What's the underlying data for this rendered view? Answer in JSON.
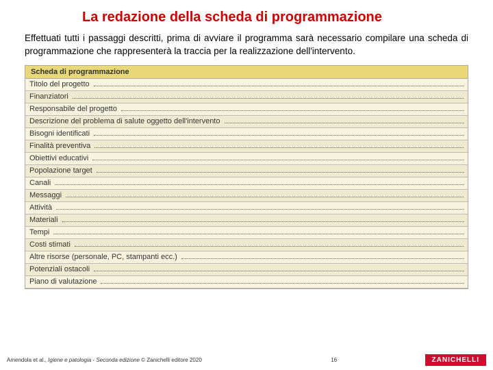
{
  "title": "La redazione della scheda di programmazione",
  "intro": "Effettuati tutti i passaggi descritti, prima di avviare il programma sarà necessario compilare una scheda di programmazione che rappresenterà la traccia per la realizzazione dell'intervento.",
  "table": {
    "header": "Scheda di programmazione",
    "rows": [
      "Titolo del progetto",
      "Finanziatori",
      "Responsabile del progetto",
      "Descrizione del problema di salute oggetto dell'intervento",
      "Bisogni identificati",
      "Finalità preventiva",
      "Obiettivi educativi",
      "Popolazione target",
      "Canali",
      "Messaggi",
      "Attività",
      "Materiali",
      "Tempi",
      "Costi stimati",
      "Altre risorse (personale, PC, stampanti ecc.)",
      "Potenziali ostacoli",
      "Piano di valutazione"
    ]
  },
  "footer": {
    "authors": "Amendola et al., ",
    "book": "Igiene e patologia - Seconda edizione",
    "publisher": " © Zanichelli editore 2020",
    "page": "16",
    "logo": "ZANICHELLI"
  }
}
